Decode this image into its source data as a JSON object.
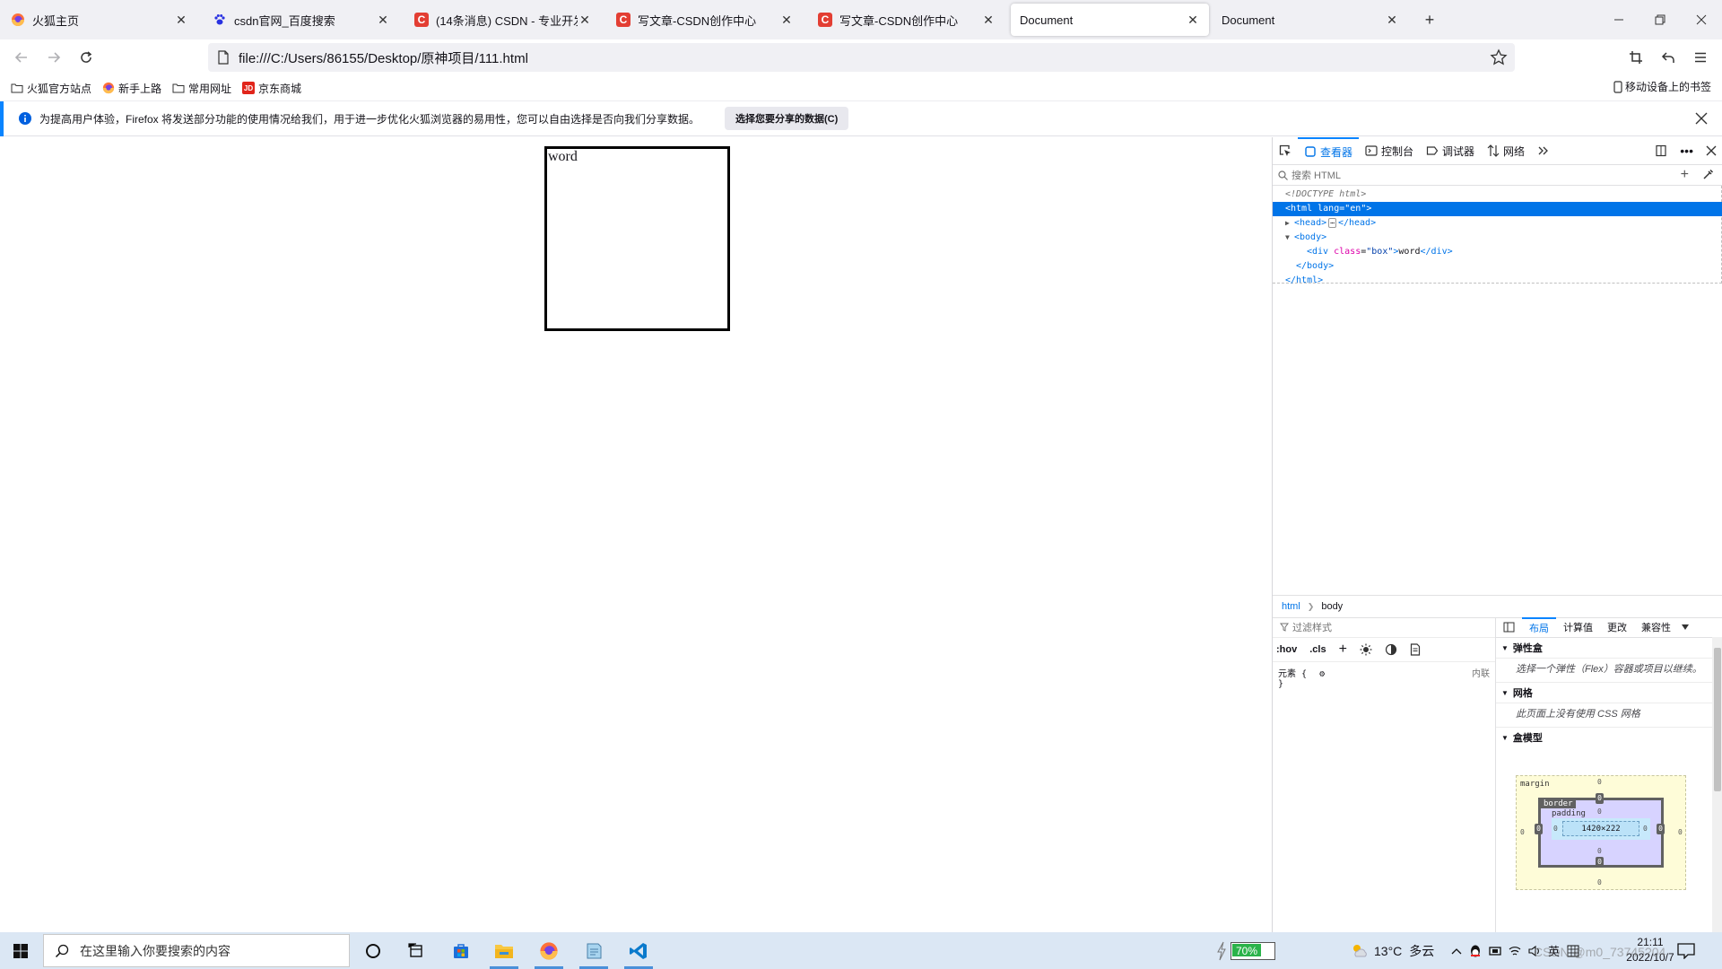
{
  "tabs": [
    {
      "title": "火狐主页",
      "favicon": "firefox-icon",
      "active": false
    },
    {
      "title": "csdn官网_百度搜索",
      "favicon": "baidu-paw-icon",
      "active": false
    },
    {
      "title": "(14条消息) CSDN - 专业开发者",
      "favicon": "csdn-c-icon",
      "active": false
    },
    {
      "title": "写文章-CSDN创作中心",
      "favicon": "csdn-c-icon",
      "active": false
    },
    {
      "title": "写文章-CSDN创作中心",
      "favicon": "csdn-c-icon",
      "active": false
    },
    {
      "title": "Document",
      "favicon": "",
      "active": true
    },
    {
      "title": "Document",
      "favicon": "",
      "active": false
    }
  ],
  "csdn_letter": "C",
  "nav": {
    "url": "file:///C:/Users/86155/Desktop/原神项目/111.html"
  },
  "bookmarks": [
    {
      "label": "火狐官方站点",
      "icon": "folder-icon"
    },
    {
      "label": "新手上路",
      "icon": "firefox-icon"
    },
    {
      "label": "常用网址",
      "icon": "folder-icon"
    },
    {
      "label": "京东商城",
      "icon": "jd-icon"
    }
  ],
  "jd_letters": "JD",
  "mobile_bookmarks": "移动设备上的书签",
  "notification": {
    "text": "为提高用户体验，Firefox 将发送部分功能的使用情况给我们，用于进一步优化火狐浏览器的易用性，您可以自由选择是否向我们分享数据。",
    "button": "选择您要分享的数据(C)"
  },
  "page": {
    "box_text": "word"
  },
  "devtools": {
    "tabs": [
      {
        "label": "查看器",
        "icon": "inspector-icon",
        "selected": true
      },
      {
        "label": "控制台",
        "icon": "console-icon",
        "selected": false
      },
      {
        "label": "调试器",
        "icon": "debugger-icon",
        "selected": false
      },
      {
        "label": "网络",
        "icon": "network-icon",
        "selected": false
      }
    ],
    "search_placeholder": "搜索 HTML",
    "markup": {
      "doctype": "<!DOCTYPE html>",
      "html_open": "<html",
      "html_attr": "lang",
      "html_val": "\"en\"",
      "head_open": "<head>",
      "head_close": "</head>",
      "body_open": "<body>",
      "div_open": "<div",
      "div_attr": "class",
      "div_val": "\"box\"",
      "div_text": "word",
      "div_close": "</div>",
      "body_close": "</body>",
      "html_close": "</html>"
    },
    "breadcrumb": [
      "html",
      "body"
    ],
    "rules": {
      "filter_placeholder": "过滤样式",
      "hov": ":hov",
      "cls": ".cls",
      "element_label": "元素",
      "open_brace": "{",
      "close_brace": "}",
      "inline_label": "内联"
    },
    "layout_tabs": [
      "布局",
      "计算值",
      "更改",
      "兼容性"
    ],
    "flexbox_title": "弹性盒",
    "flexbox_desc": "选择一个弹性（Flex）容器或项目以继续。",
    "grid_title": "网格",
    "grid_desc": "此页面上没有使用 CSS 网格",
    "boxmodel_title": "盒模型",
    "boxmodel": {
      "margin_label": "margin",
      "border_label": "border",
      "padding_label": "padding",
      "content_size": "1420×222",
      "zero": "0"
    }
  },
  "taskbar": {
    "search_placeholder": "在这里输入你要搜索的内容",
    "battery": "70%",
    "weather_temp": "13°C",
    "weather_desc": "多云",
    "ime": "英",
    "time": "21:11",
    "date": "2022/10/7",
    "watermark": "CSDN @m0_73745?04"
  }
}
